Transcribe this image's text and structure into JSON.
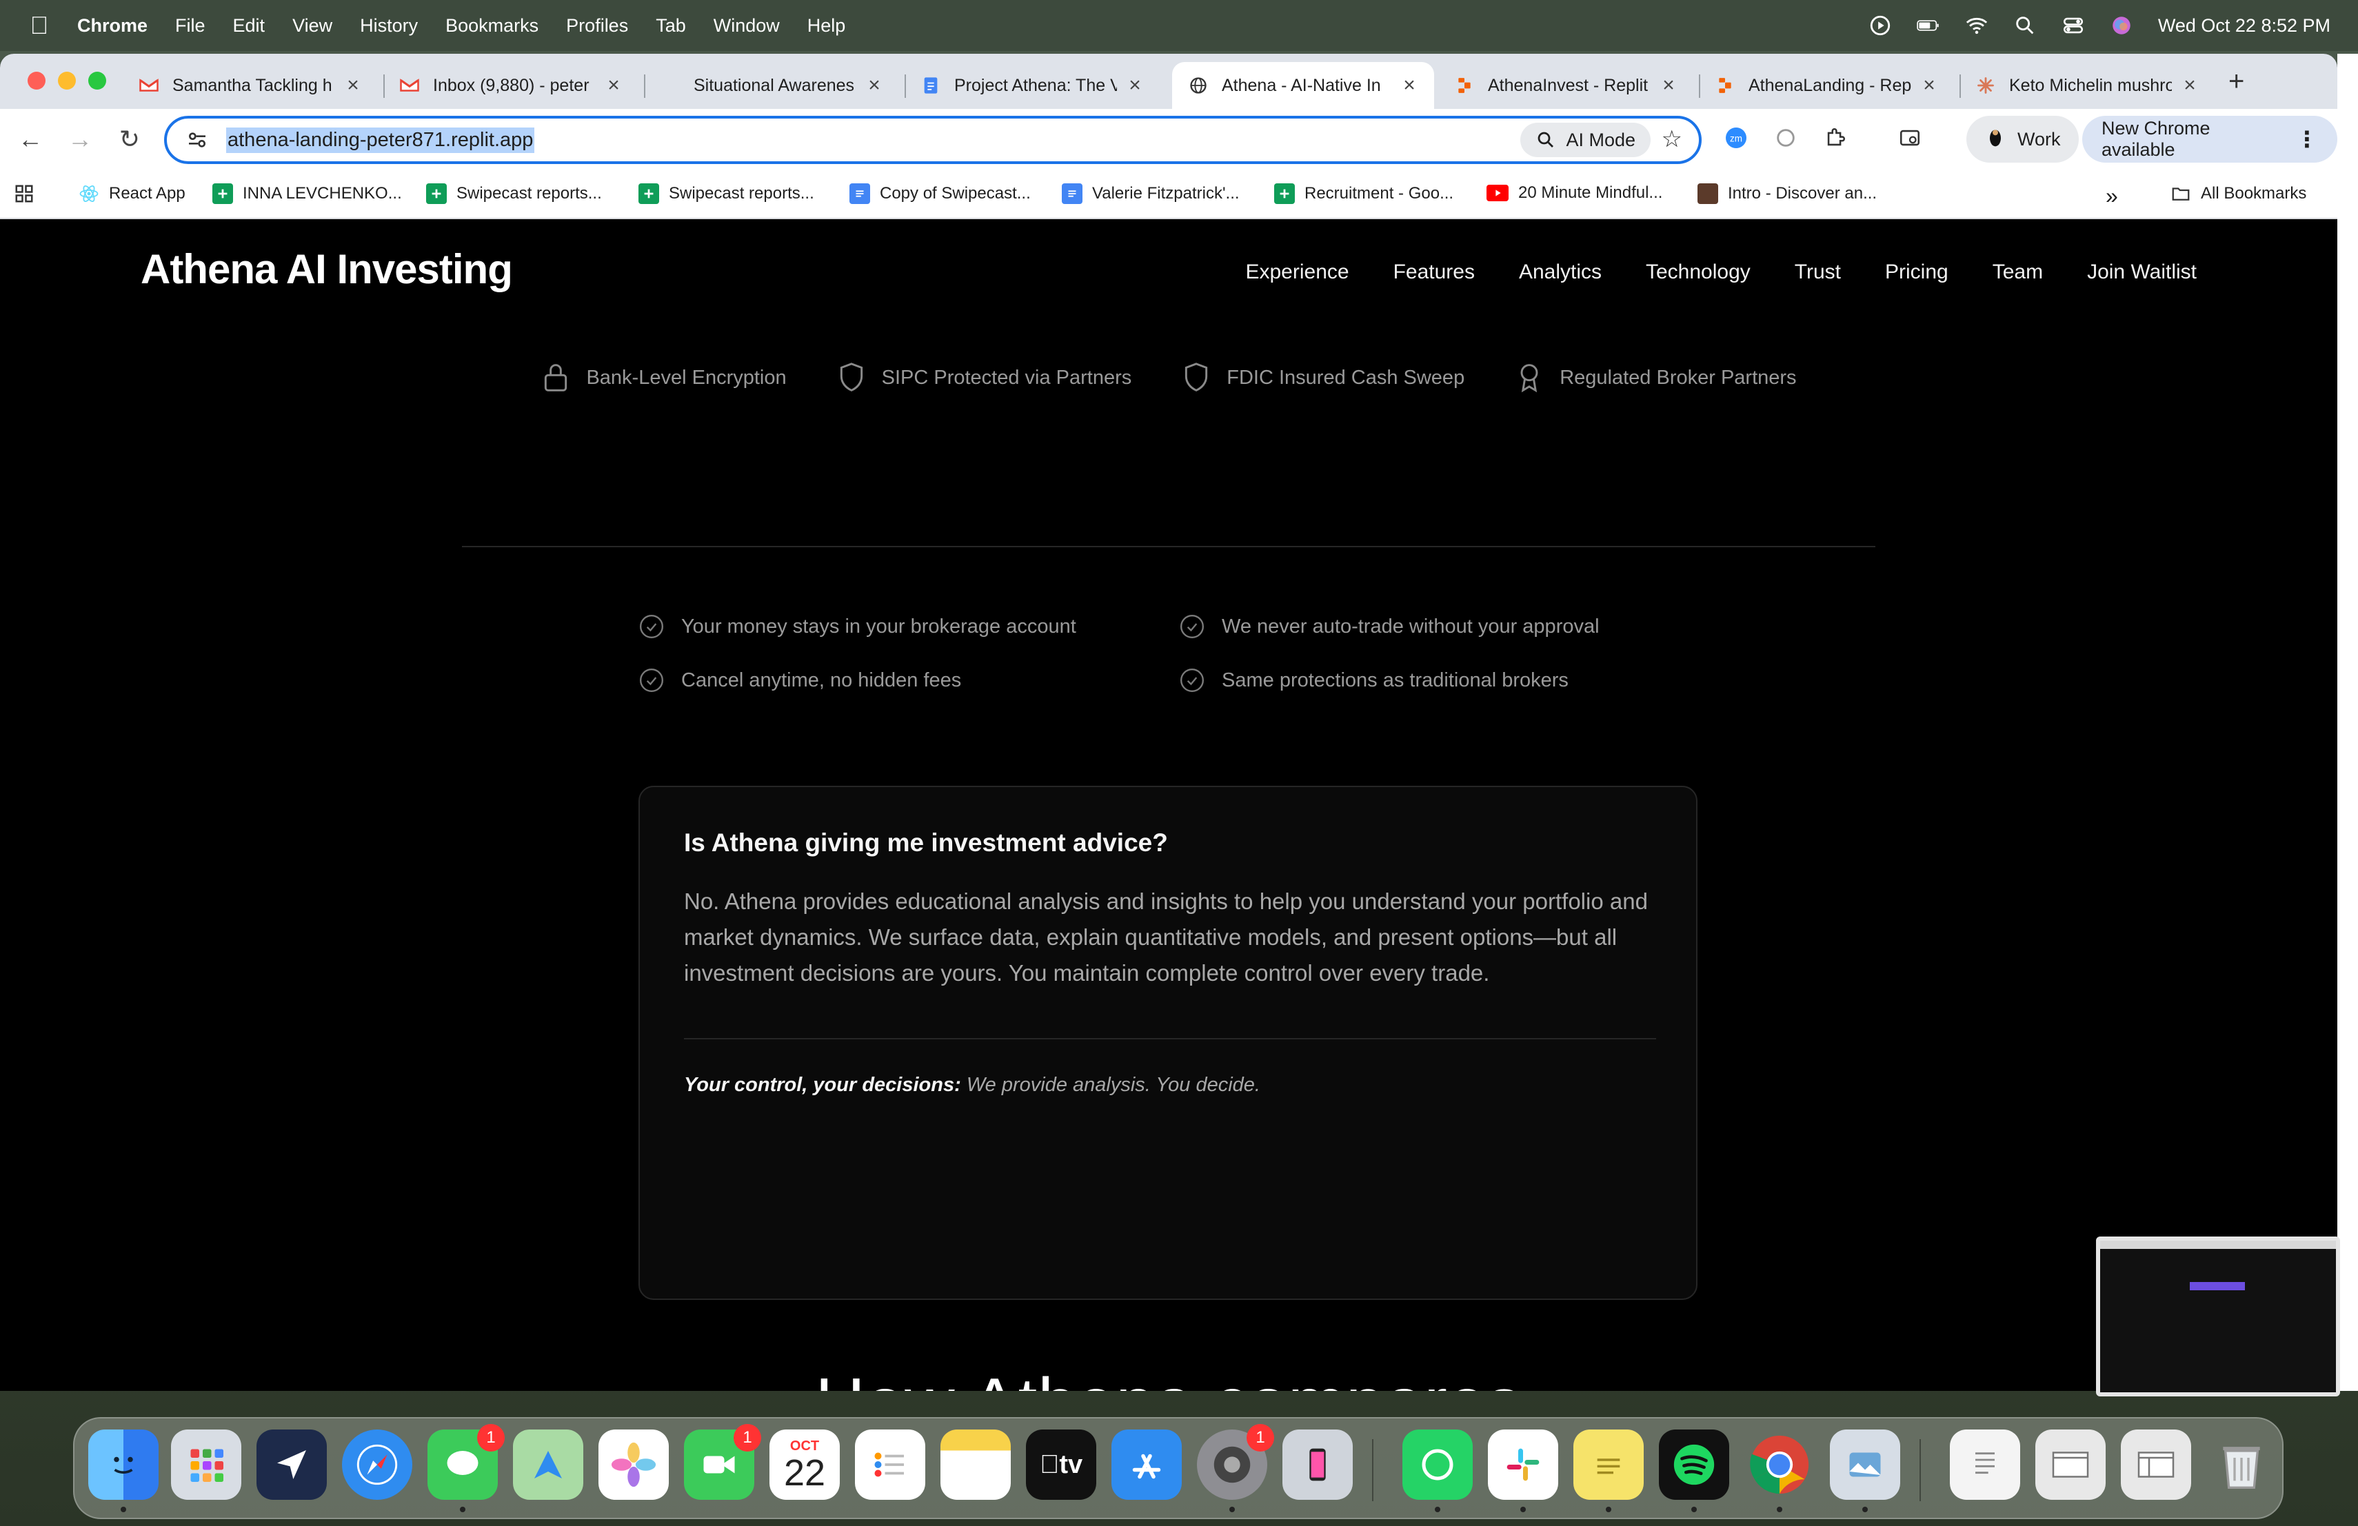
{
  "menubar": {
    "app_name": "Chrome",
    "menus": [
      "File",
      "Edit",
      "View",
      "History",
      "Bookmarks",
      "Profiles",
      "Tab",
      "Window",
      "Help"
    ],
    "datetime": "Wed Oct 22  8:52 PM"
  },
  "tabs": [
    {
      "title": "Samantha Tackling h",
      "icon": "gmail-icon"
    },
    {
      "title": "Inbox (9,880) - peter",
      "icon": "gmail-icon"
    },
    {
      "title": "Situational Awarenes",
      "icon": "blank-icon"
    },
    {
      "title": "Project Athena: The V",
      "icon": "docs-icon"
    },
    {
      "title": "Athena - AI-Native In",
      "icon": "globe-icon",
      "active": true
    },
    {
      "title": "AthenaInvest - Replit",
      "icon": "replit-icon"
    },
    {
      "title": "AthenaLanding - Rep",
      "icon": "replit-icon"
    },
    {
      "title": "Keto Michelin mushro",
      "icon": "claude-icon"
    }
  ],
  "toolbar": {
    "url": "athena-landing-peter871.replit.app",
    "ai_mode_label": "AI Mode",
    "profile_label": "Work",
    "update_label": "New Chrome available"
  },
  "bookmarks": {
    "items": [
      {
        "label": "React App",
        "icon": "react-icon"
      },
      {
        "label": "INNA LEVCHENKO...",
        "icon": "sheets-icon"
      },
      {
        "label": "Swipecast reports...",
        "icon": "sheets-icon"
      },
      {
        "label": "Swipecast reports...",
        "icon": "sheets-icon"
      },
      {
        "label": "Copy of Swipecast...",
        "icon": "docs-icon"
      },
      {
        "label": "Valerie Fitzpatrick'...",
        "icon": "docs-icon"
      },
      {
        "label": "Recruitment - Goo...",
        "icon": "sheets-icon"
      },
      {
        "label": "20 Minute Mindful...",
        "icon": "youtube-icon"
      },
      {
        "label": "Intro - Discover an...",
        "icon": "site-icon"
      }
    ],
    "more": "»",
    "all_label": "All Bookmarks"
  },
  "site": {
    "logo": "Athena AI Investing",
    "nav": [
      "Experience",
      "Features",
      "Analytics",
      "Technology",
      "Trust",
      "Pricing",
      "Team",
      "Join Waitlist"
    ],
    "trust_badges": [
      {
        "label": "Bank-Level Encryption",
        "icon": "lock-icon"
      },
      {
        "label": "SIPC Protected via Partners",
        "icon": "shield-icon"
      },
      {
        "label": "FDIC Insured Cash Sweep",
        "icon": "shield-icon"
      },
      {
        "label": "Regulated Broker Partners",
        "icon": "award-icon"
      }
    ],
    "assurances": [
      "Your money stays in your brokerage account",
      "We never auto-trade without your approval",
      "Cancel anytime, no hidden fees",
      "Same protections as traditional brokers"
    ],
    "faq": {
      "question": "Is Athena giving me investment advice?",
      "answer": "No. Athena provides educational analysis and insights to help you understand your portfolio and market dynamics. We surface data, explain quantitative models, and present options—but all investment decisions are yours. You maintain complete control over every trade.",
      "footer_bold": "Your control, your decisions:",
      "footer_text": " We provide analysis. You decide."
    },
    "section_title": "How Athena compares"
  },
  "dock": {
    "apps": [
      "Finder",
      "Launchpad",
      "Copilot",
      "Safari",
      "Messages",
      "Maps",
      "Photos",
      "FaceTime",
      "Calendar",
      "Reminders",
      "Notes",
      "TV",
      "App Store",
      "System Settings",
      "iPhone Mirroring",
      "WhatsApp",
      "Slack",
      "Stickies",
      "Spotify",
      "Chrome",
      "Preview",
      "Document",
      "Window",
      "Window",
      "Trash"
    ],
    "calendar_month": "OCT",
    "calendar_day": "22",
    "badges": {
      "messages": "1",
      "facetime": "1",
      "settings": "1"
    }
  }
}
